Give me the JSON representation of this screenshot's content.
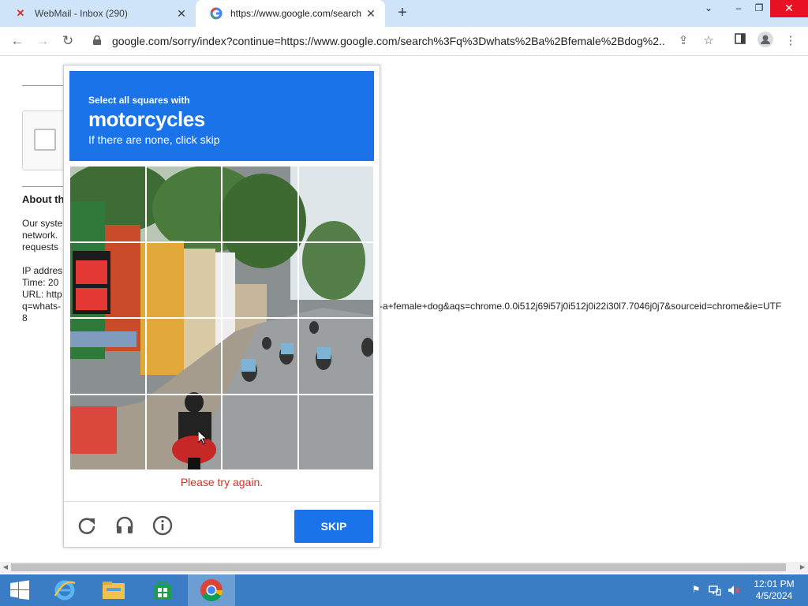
{
  "browser": {
    "tabs": [
      {
        "title": "WebMail - Inbox (290)",
        "favicon": "webmail-x-icon",
        "active": false
      },
      {
        "title": "https://www.google.com/search?",
        "favicon": "google-g-icon",
        "active": true
      }
    ],
    "url": "google.com/sorry/index?continue=https://www.google.com/search%3Fq%3Dwhats%2Ba%2Bfemale%2Bdog%2..."
  },
  "page": {
    "about_heading": "About th",
    "para_lines": [
      "Our syste",
      "network.",
      "requests"
    ],
    "ip_label": "IP addres",
    "time_label": "Time: 20",
    "url_label": "URL: http",
    "url_cont": "q=whats-",
    "url_cont_right": "-a+female+dog&aqs=chrome.0.0i512j69i57j0i512j0i22i30l7.7046j0j7&sourceid=chrome&ie=UTF",
    "url_last": "8"
  },
  "captcha": {
    "instruction_small": "Select all squares with",
    "target": "motorcycles",
    "instruction_sub": "If there are none, click skip",
    "error": "Please try again.",
    "skip_label": "SKIP",
    "grid_size": 4,
    "colors": {
      "accent": "#1a73e8",
      "error": "#d93025"
    }
  },
  "taskbar": {
    "apps": [
      "windows-start-icon",
      "internet-explorer-icon",
      "file-explorer-icon",
      "store-icon",
      "chrome-icon"
    ],
    "time": "12:01 PM",
    "date": "4/5/2024"
  }
}
